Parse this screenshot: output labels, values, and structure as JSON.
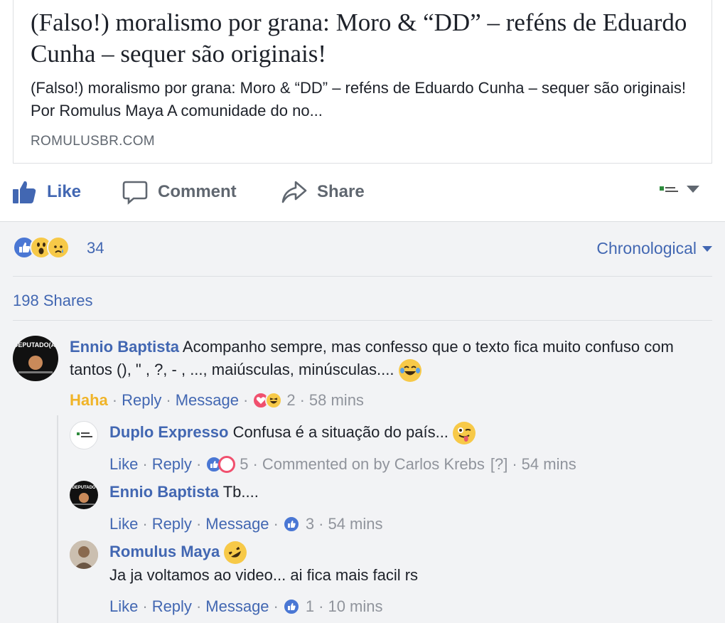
{
  "link_preview": {
    "title": "(Falso!) moralismo por grana: Moro & “DD” – reféns de Eduardo Cunha – sequer são originais!",
    "description": "(Falso!) moralismo por grana: Moro & “DD” – reféns de Eduardo Cunha – sequer são originais! Por Romulus Maya A comunidade do no...",
    "domain": "ROMULUSBR.COM"
  },
  "actions": {
    "like": "Like",
    "comment": "Comment",
    "share": "Share"
  },
  "reactions": {
    "count": "34",
    "sort_label": "Chronological"
  },
  "shares": "198 Shares",
  "comments": [
    {
      "author": "Ennio Baptista",
      "text": "Acompanho sempre, mas confesso que o texto fica muito confuso com tantos (), \" , ?, - , ..., maiúsculas, minúsculas....",
      "reaction_label": "Haha",
      "reply": "Reply",
      "message": "Message",
      "reaction_count": "2",
      "time": "58 mins"
    },
    {
      "author": "Duplo Expresso",
      "text": "Confusa é a situação do país...",
      "like": "Like",
      "reply": "Reply",
      "reaction_count": "5",
      "commented_on": "Commented on by Carlos Krebs",
      "help": "[?]",
      "time": "54 mins"
    },
    {
      "author": "Ennio Baptista",
      "text": "Tb....",
      "like": "Like",
      "reply": "Reply",
      "message": "Message",
      "reaction_count": "3",
      "time": "54 mins"
    },
    {
      "author": "Romulus Maya",
      "text": "Ja ja voltamos ao video... ai fica mais facil rs",
      "like": "Like",
      "reply": "Reply",
      "message": "Message",
      "reaction_count": "1",
      "time": "10 mins"
    }
  ],
  "colors": {
    "link_blue": "#4267b2",
    "haha_yellow": "#f0b429",
    "meta_grey": "#90949c",
    "background_grey": "#f2f3f5"
  }
}
